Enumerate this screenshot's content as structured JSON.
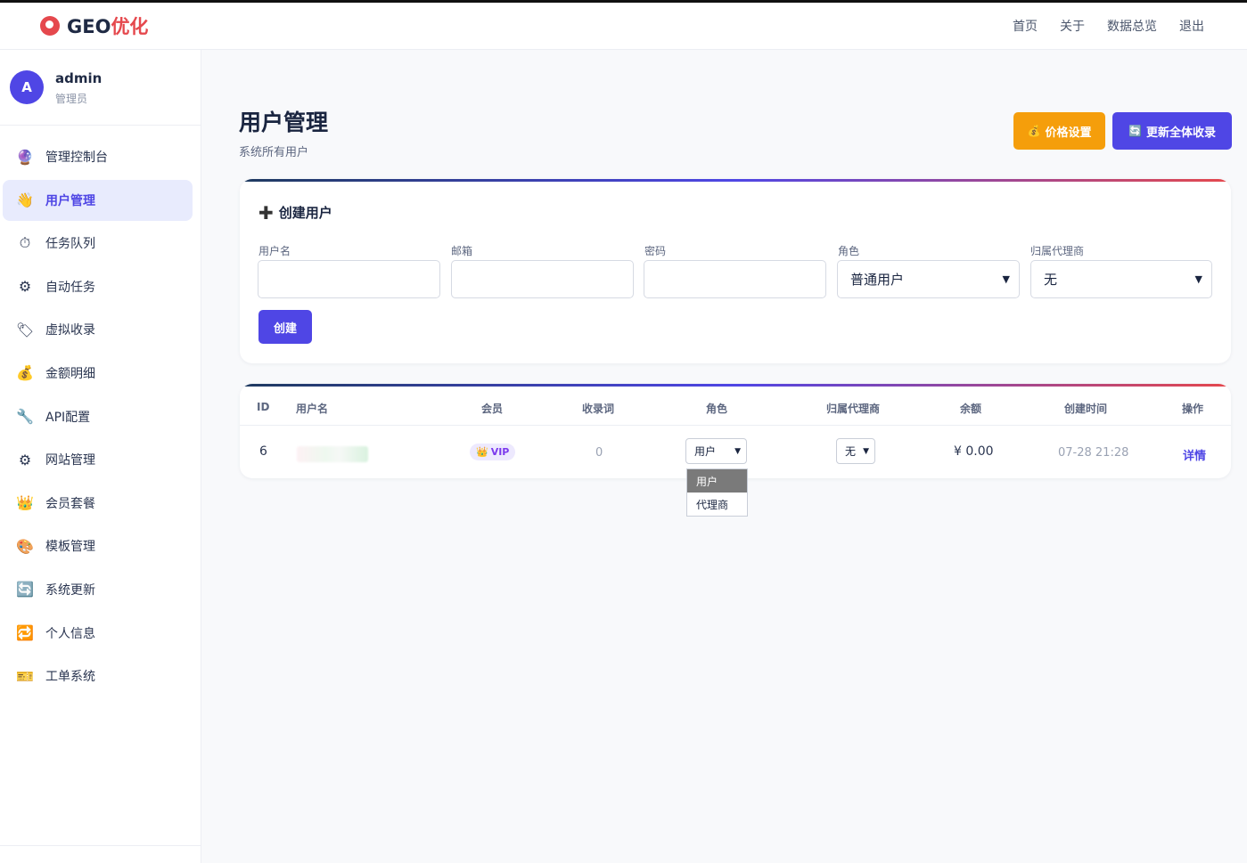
{
  "brand": {
    "prefix": "GEO",
    "suffix": "优化"
  },
  "topnav": [
    "首页",
    "关于",
    "数据总览",
    "退出"
  ],
  "user": {
    "avatar": "A",
    "name": "admin",
    "role": "管理员"
  },
  "sidebar": {
    "items": [
      {
        "label": "管理控制台",
        "icon": "🔮"
      },
      {
        "label": "用户管理",
        "icon": "👋",
        "active": true
      },
      {
        "label": "任务队列",
        "icon": "⏱"
      },
      {
        "label": "自动任务",
        "icon": "⚙"
      },
      {
        "label": "虚拟收录",
        "icon": "🏷"
      },
      {
        "label": "金额明细",
        "icon": "💰"
      },
      {
        "label": "API配置",
        "icon": "🔧"
      },
      {
        "label": "网站管理",
        "icon": "⚙"
      },
      {
        "label": "会员套餐",
        "icon": "👑"
      },
      {
        "label": "模板管理",
        "icon": "🎨"
      },
      {
        "label": "系统更新",
        "icon": "🔄"
      },
      {
        "label": "个人信息",
        "icon": "🔁"
      },
      {
        "label": "工单系统",
        "icon": "🎫"
      }
    ]
  },
  "page": {
    "title": "用户管理",
    "subtitle": "系统所有用户"
  },
  "actions": {
    "price": "价格设置",
    "price_icon": "💰",
    "update": "更新全体收录",
    "update_icon": "🔄"
  },
  "create_form": {
    "title": "创建用户",
    "fields": {
      "username": "用户名",
      "email": "邮箱",
      "password": "密码",
      "role": "角色",
      "agent": "归属代理商"
    },
    "role_value": "普通用户",
    "agent_value": "无",
    "submit": "创建"
  },
  "table": {
    "headers": [
      "ID",
      "用户名",
      "会员",
      "收录词",
      "角色",
      "归属代理商",
      "余额",
      "创建时间",
      "操作"
    ],
    "rows": [
      {
        "id": "6",
        "membership": "VIP",
        "keywords": "0",
        "role": "用户",
        "agent": "无",
        "balance": "¥ 0.00",
        "created": "07-28 21:28",
        "action": "详情"
      }
    ]
  },
  "role_dropdown": {
    "options": [
      "用户",
      "代理商"
    ],
    "selected": "用户"
  }
}
